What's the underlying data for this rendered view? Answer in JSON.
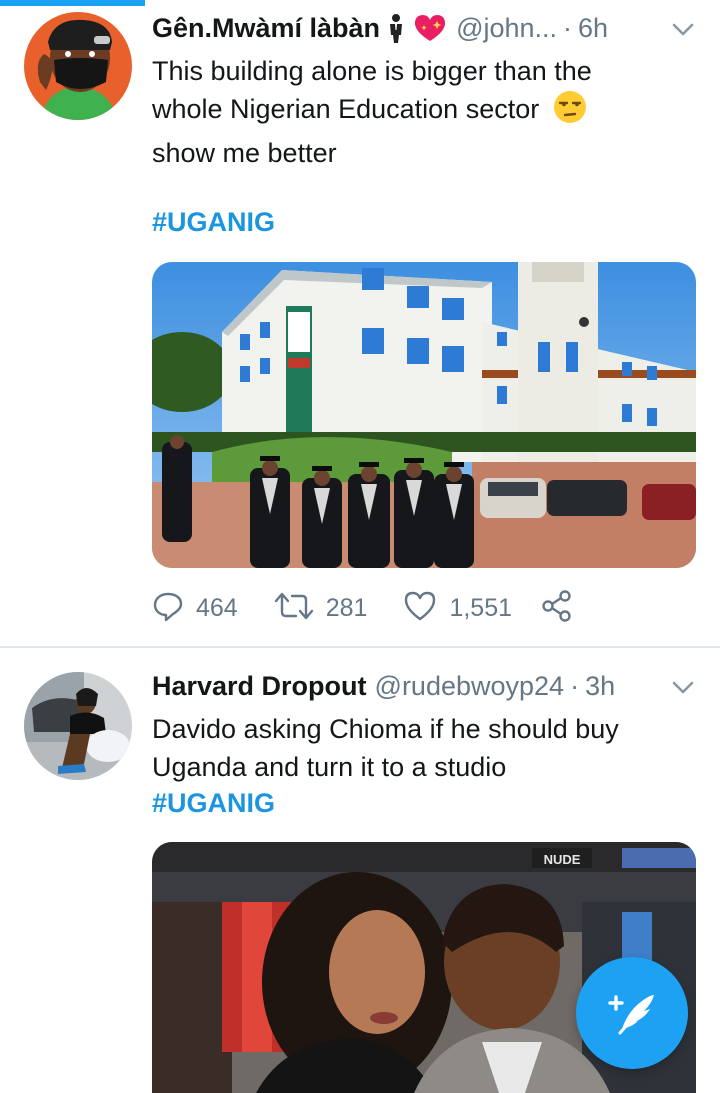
{
  "tweets": [
    {
      "display_name": "Gên.Mwàmí làbàn",
      "badges": [
        "man-in-suit-emoji",
        "sparkling-heart-emoji"
      ],
      "handle": "@john...",
      "separator": "·",
      "time": "6h",
      "text_lines": [
        "This building alone is bigger than the",
        "whole Nigerian Education sector",
        "show me better"
      ],
      "text_emoji": "unamused-face-emoji",
      "hashtag": "#UGANIG",
      "actions": {
        "replies": "464",
        "retweets": "281",
        "likes": "1,551"
      }
    },
    {
      "display_name": "Harvard Dropout",
      "handle": "@rudebwoyp24",
      "separator": "·",
      "time": "3h",
      "text_lines": [
        "Davido asking Chioma if he should buy",
        "Uganda and turn it to a studio"
      ],
      "hashtag": "#UGANIG",
      "media_sign": "NUDE"
    }
  ],
  "colors": {
    "accent": "#1da1f2",
    "hashtag": "#1b95e0",
    "muted": "#657786",
    "text": "#14171a",
    "divider": "#e1e8ed"
  },
  "icons": {
    "reply": "reply-icon",
    "retweet": "retweet-icon",
    "like": "heart-icon",
    "share": "share-icon",
    "caret": "chevron-down-icon",
    "compose": "compose-tweet-icon"
  }
}
